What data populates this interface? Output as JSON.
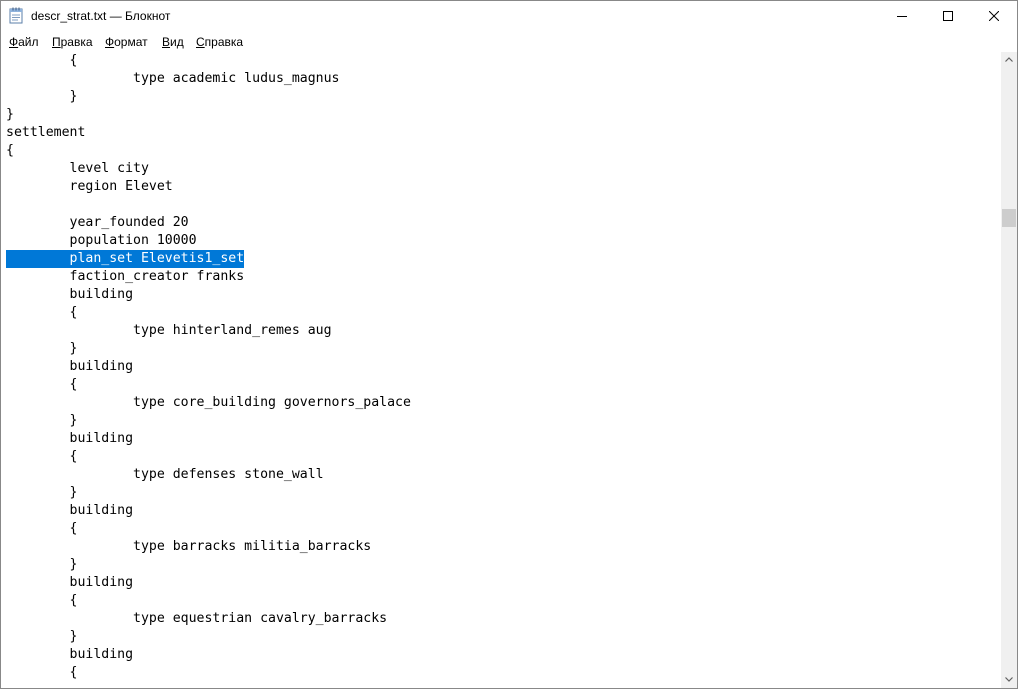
{
  "window": {
    "title": "descr_strat.txt — Блокнот"
  },
  "menu": [
    {
      "accel": "Ф",
      "rest": "айл"
    },
    {
      "accel": "П",
      "rest": "равка"
    },
    {
      "accel": "Ф",
      "rest": "ормат"
    },
    {
      "accel": "В",
      "rest": "ид"
    },
    {
      "accel": "С",
      "rest": "правка"
    }
  ],
  "editor": {
    "selected_line_index": 11,
    "lines": [
      "        {",
      "                type academic ludus_magnus",
      "        }",
      "}",
      "settlement",
      "{",
      "        level city",
      "        region Elevet",
      "",
      "        year_founded 20",
      "        population 10000",
      "        plan_set Elevetis1_set",
      "        faction_creator franks",
      "        building",
      "        {",
      "                type hinterland_remes aug",
      "        }",
      "        building",
      "        {",
      "                type core_building governors_palace",
      "        }",
      "        building",
      "        {",
      "                type defenses stone_wall",
      "        }",
      "        building",
      "        {",
      "                type barracks militia_barracks",
      "        }",
      "        building",
      "        {",
      "                type equestrian cavalry_barracks",
      "        }",
      "        building",
      "        {"
    ]
  },
  "scrollbar": {
    "position_fraction": 0.24
  },
  "icons": {
    "app": "notepad-icon",
    "minimize": "minimize-icon",
    "maximize": "maximize-icon",
    "close": "close-icon",
    "scroll_up": "chevron-up-icon",
    "scroll_down": "chevron-down-icon"
  },
  "colors": {
    "selection": "#0078d7",
    "selection_text": "#ffffff",
    "scrollbar_track": "#f0f0f0",
    "scrollbar_thumb": "#cdcdcd"
  }
}
